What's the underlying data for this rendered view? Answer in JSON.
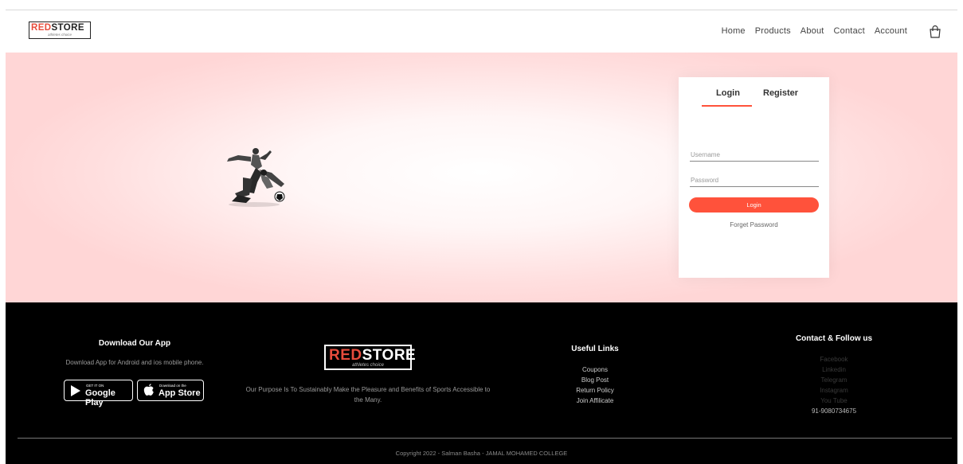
{
  "header": {
    "logo_word_black": "RED",
    "logo_word_rest": "STORE",
    "logo_tagline": "athletes choice",
    "nav": [
      "Home",
      "Products",
      "About",
      "Contact",
      "Account"
    ],
    "icons": {
      "cart": "shopping-bag-icon"
    }
  },
  "login_form": {
    "tab_login": "Login",
    "tab_register": "Register",
    "username_placeholder": "Username",
    "password_placeholder": "Password",
    "login_button": "Login",
    "forget_password": "Forget Password"
  },
  "footer": {
    "app": {
      "title": "Download Our App",
      "text": "Download App for Android and ios mobile phone.",
      "google_small": "GET IT ON",
      "google_big": "Google Play",
      "apple_small": "Download on the",
      "apple_big": "App Store"
    },
    "brand": {
      "logo_word_red": "RED",
      "logo_word_rest": "STORE",
      "logo_tagline": "athletes choice",
      "purpose": "Our Purpose Is To Sustainably Make the Pleasure and Benefits of Sports Accessible to the Many."
    },
    "useful_links": {
      "title": "Useful Links",
      "items": [
        "Coupons",
        "Blog Post",
        "Return Policy",
        "Join Affilicate"
      ]
    },
    "contact": {
      "title": "Contact & Follow us",
      "items": [
        "Facebook",
        "Linkedin",
        "Telegram",
        "Instagram",
        "You Tube"
      ],
      "phone": "91-9080734675"
    },
    "copyright": "Copyright 2022 - Salman Basha - JAMAL MOHAMED COLLEGE"
  },
  "colors": {
    "accent": "#ff523b",
    "hero_bg": "#ffd6d6",
    "footer_bg": "#000000"
  }
}
